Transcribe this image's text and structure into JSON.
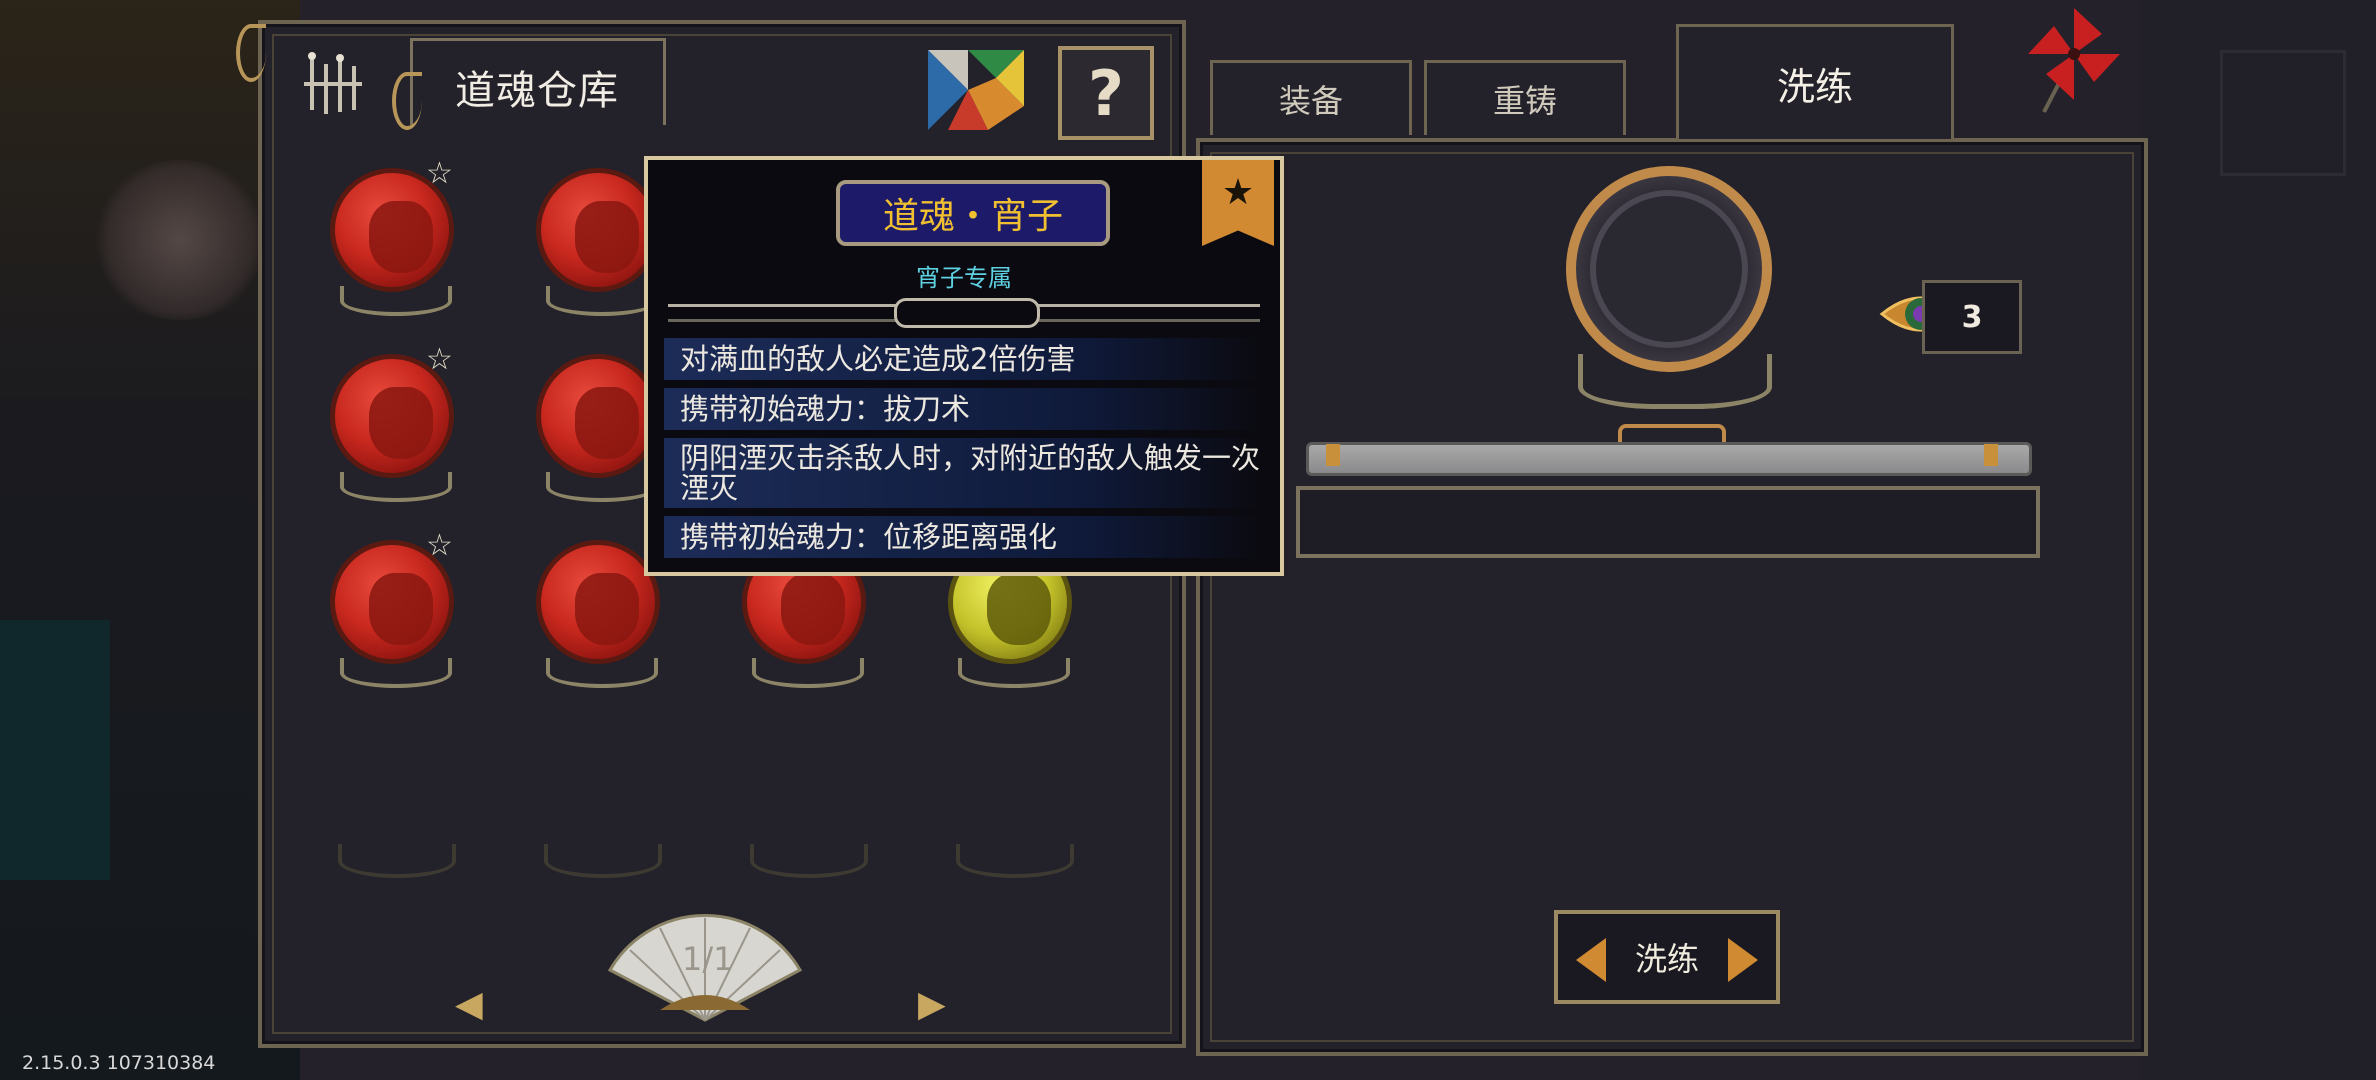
{
  "warehouse": {
    "title": "道魂仓库",
    "help_label": "?"
  },
  "tabs": [
    {
      "label": "装备",
      "active": false
    },
    {
      "label": "重铸",
      "active": false
    },
    {
      "label": "洗练",
      "active": true
    }
  ],
  "soul_grid": [
    {
      "color": "red",
      "starred": true
    },
    {
      "color": "red",
      "starred": false
    },
    {
      "color": "red",
      "starred": false
    },
    {
      "color": "red",
      "starred": false
    },
    {
      "color": "red",
      "starred": true
    },
    {
      "color": "red",
      "starred": false
    },
    {
      "color": "red",
      "starred": false
    },
    {
      "color": "red",
      "starred": false
    },
    {
      "color": "red",
      "starred": true
    },
    {
      "color": "red",
      "starred": false
    },
    {
      "color": "red",
      "starred": false
    },
    {
      "color": "gold",
      "starred": false
    }
  ],
  "star_glyph": "☆",
  "pagination": {
    "page": "1/1",
    "prev_glyph": "◀",
    "next_glyph": "▶"
  },
  "tooltip": {
    "title": "道魂・宵子",
    "badge_glyph": "★",
    "subtitle": "宵子专属",
    "lines": [
      "对满血的敌人必定造成2倍伤害",
      "携带初始魂力：拔刀术",
      "阴阳湮灭击杀敌人时，对附近的敌人触发一次湮灭",
      "携带初始魂力：位移距离强化"
    ]
  },
  "refine": {
    "material_count": "3",
    "button_label": "洗练"
  },
  "version": "2.15.0.3 107310384",
  "colors": {
    "accent_gold": "#c08a4a",
    "tooltip_title": "#f0c030",
    "subtitle_cyan": "#5ed2e2",
    "panel_bg": "#23212a"
  }
}
